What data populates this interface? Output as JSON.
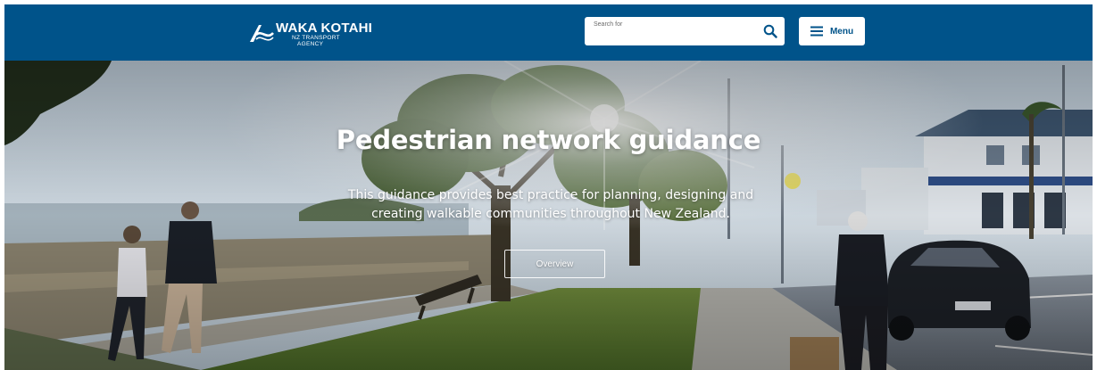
{
  "header": {
    "logo": {
      "title": "WAKA KOTAHI",
      "subtitle_line1": "NZ TRANSPORT",
      "subtitle_line2": "AGENCY"
    },
    "search": {
      "placeholder": "Search for",
      "icon": "search-icon"
    },
    "menu": {
      "label": "Menu",
      "icon": "hamburger-icon"
    },
    "background_color": "#00538a"
  },
  "hero": {
    "title": "Pedestrian network guidance",
    "description": "This guidance provides best practice for planning, designing and creating walkable communities throughout New Zealand.",
    "cta_label": "Overview"
  }
}
